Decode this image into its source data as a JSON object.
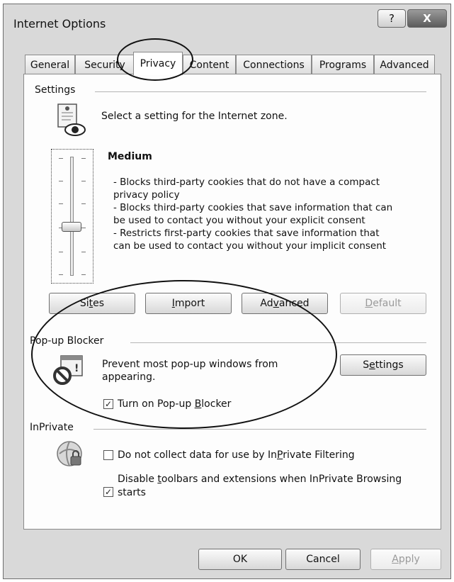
{
  "window": {
    "title": "Internet Options",
    "help_glyph": "?",
    "close_glyph": "X"
  },
  "tabs": [
    {
      "label": "General"
    },
    {
      "label": "Security"
    },
    {
      "label": "Privacy",
      "selected": true
    },
    {
      "label": "Content"
    },
    {
      "label": "Connections"
    },
    {
      "label": "Programs"
    },
    {
      "label": "Advanced"
    }
  ],
  "settings": {
    "group_label": "Settings",
    "zone_prompt": "Select a setting for the Internet zone.",
    "level_title": "Medium",
    "level_slider_position": "3 of 6",
    "description_lines": [
      "- Blocks third-party cookies that do not have a compact",
      "privacy policy",
      "- Blocks third-party cookies that save information that can",
      "be used to contact you without your explicit consent",
      "- Restricts first-party cookies that save information that",
      "can be used to contact you without your implicit consent"
    ],
    "buttons": {
      "sites": {
        "pre": "Si",
        "acc": "t",
        "post": "es"
      },
      "import": {
        "pre": "",
        "acc": "I",
        "post": "mport"
      },
      "advanced": {
        "pre": "Ad",
        "acc": "v",
        "post": "anced"
      },
      "default": {
        "pre": "",
        "acc": "D",
        "post": "efault"
      }
    }
  },
  "popup_blocker": {
    "group_label": "Pop-up Blocker",
    "description_line1": "Prevent most pop-up windows from",
    "description_line2": "appearing.",
    "settings_button": {
      "pre": "S",
      "acc": "e",
      "post": "ttings"
    },
    "toggle": {
      "pre": "Turn on Pop-up ",
      "acc": "B",
      "post": "locker",
      "checked": true
    }
  },
  "inprivate": {
    "group_label": "InPrivate",
    "option1": {
      "pre": "Do not collect data for use by In",
      "acc": "P",
      "post": "rivate Filtering",
      "checked": false
    },
    "option2": {
      "line1_pre": "Disable ",
      "line1_acc": "t",
      "line1_post": "oolbars and extensions when InPrivate Browsing",
      "line2": "starts",
      "checked": true
    }
  },
  "footer": {
    "ok": "OK",
    "cancel": "Cancel",
    "apply": {
      "pre": "",
      "acc": "A",
      "post": "pply"
    }
  },
  "icon_names": [
    "privacy-report-icon",
    "popup-blocked-icon",
    "inprivate-shield-icon",
    "help-icon",
    "close-icon"
  ]
}
